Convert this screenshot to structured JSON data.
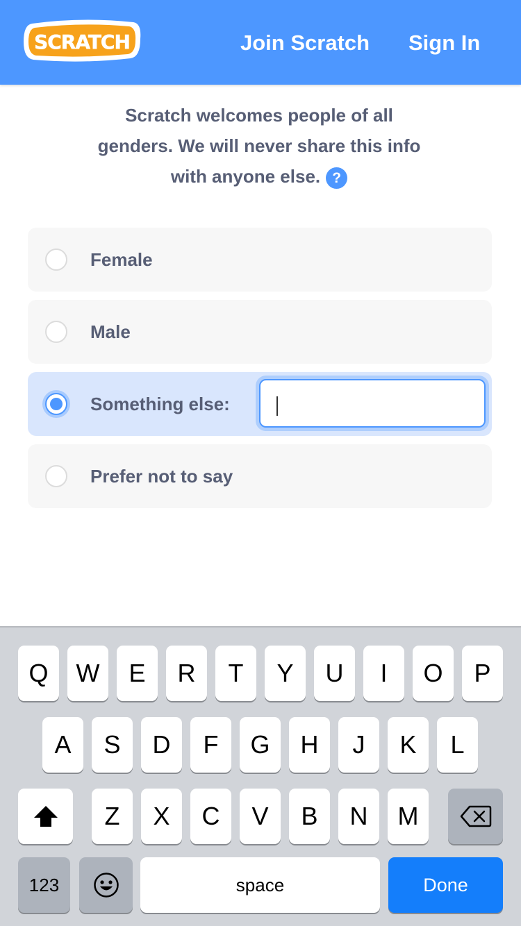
{
  "header": {
    "logo_text": "SCRATCH",
    "brand_color": "#4d97ff",
    "nav": {
      "join": "Join Scratch",
      "signin": "Sign In"
    }
  },
  "intro": {
    "line1": "Scratch welcomes people of all",
    "line2": "genders. We will never share this info",
    "line3": "with anyone else.",
    "help_icon": "?"
  },
  "options": [
    {
      "label": "Female",
      "selected": false
    },
    {
      "label": "Male",
      "selected": false
    },
    {
      "label": "Something else:",
      "selected": true,
      "input_value": ""
    },
    {
      "label": "Prefer not to say",
      "selected": false
    }
  ],
  "keyboard": {
    "row1": [
      "Q",
      "W",
      "E",
      "R",
      "T",
      "Y",
      "U",
      "I",
      "O",
      "P"
    ],
    "row2": [
      "A",
      "S",
      "D",
      "F",
      "G",
      "H",
      "J",
      "K",
      "L"
    ],
    "row3": [
      "Z",
      "X",
      "C",
      "V",
      "B",
      "N",
      "M"
    ],
    "shift_icon": "shift-icon",
    "backspace_icon": "backspace-icon",
    "numbers_key": "123",
    "emoji_icon": "emoji-icon",
    "space_key": "space",
    "done_key": "Done",
    "done_color": "#147efb"
  }
}
